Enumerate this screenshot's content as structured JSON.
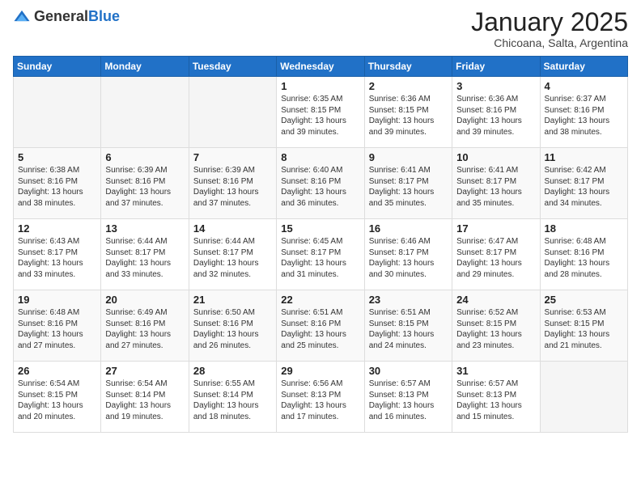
{
  "logo": {
    "general": "General",
    "blue": "Blue"
  },
  "header": {
    "month": "January 2025",
    "location": "Chicoana, Salta, Argentina"
  },
  "days_of_week": [
    "Sunday",
    "Monday",
    "Tuesday",
    "Wednesday",
    "Thursday",
    "Friday",
    "Saturday"
  ],
  "weeks": [
    [
      {
        "day": "",
        "info": ""
      },
      {
        "day": "",
        "info": ""
      },
      {
        "day": "",
        "info": ""
      },
      {
        "day": "1",
        "info": "Sunrise: 6:35 AM\nSunset: 8:15 PM\nDaylight: 13 hours and 39 minutes."
      },
      {
        "day": "2",
        "info": "Sunrise: 6:36 AM\nSunset: 8:15 PM\nDaylight: 13 hours and 39 minutes."
      },
      {
        "day": "3",
        "info": "Sunrise: 6:36 AM\nSunset: 8:16 PM\nDaylight: 13 hours and 39 minutes."
      },
      {
        "day": "4",
        "info": "Sunrise: 6:37 AM\nSunset: 8:16 PM\nDaylight: 13 hours and 38 minutes."
      }
    ],
    [
      {
        "day": "5",
        "info": "Sunrise: 6:38 AM\nSunset: 8:16 PM\nDaylight: 13 hours and 38 minutes."
      },
      {
        "day": "6",
        "info": "Sunrise: 6:39 AM\nSunset: 8:16 PM\nDaylight: 13 hours and 37 minutes."
      },
      {
        "day": "7",
        "info": "Sunrise: 6:39 AM\nSunset: 8:16 PM\nDaylight: 13 hours and 37 minutes."
      },
      {
        "day": "8",
        "info": "Sunrise: 6:40 AM\nSunset: 8:16 PM\nDaylight: 13 hours and 36 minutes."
      },
      {
        "day": "9",
        "info": "Sunrise: 6:41 AM\nSunset: 8:17 PM\nDaylight: 13 hours and 35 minutes."
      },
      {
        "day": "10",
        "info": "Sunrise: 6:41 AM\nSunset: 8:17 PM\nDaylight: 13 hours and 35 minutes."
      },
      {
        "day": "11",
        "info": "Sunrise: 6:42 AM\nSunset: 8:17 PM\nDaylight: 13 hours and 34 minutes."
      }
    ],
    [
      {
        "day": "12",
        "info": "Sunrise: 6:43 AM\nSunset: 8:17 PM\nDaylight: 13 hours and 33 minutes."
      },
      {
        "day": "13",
        "info": "Sunrise: 6:44 AM\nSunset: 8:17 PM\nDaylight: 13 hours and 33 minutes."
      },
      {
        "day": "14",
        "info": "Sunrise: 6:44 AM\nSunset: 8:17 PM\nDaylight: 13 hours and 32 minutes."
      },
      {
        "day": "15",
        "info": "Sunrise: 6:45 AM\nSunset: 8:17 PM\nDaylight: 13 hours and 31 minutes."
      },
      {
        "day": "16",
        "info": "Sunrise: 6:46 AM\nSunset: 8:17 PM\nDaylight: 13 hours and 30 minutes."
      },
      {
        "day": "17",
        "info": "Sunrise: 6:47 AM\nSunset: 8:17 PM\nDaylight: 13 hours and 29 minutes."
      },
      {
        "day": "18",
        "info": "Sunrise: 6:48 AM\nSunset: 8:16 PM\nDaylight: 13 hours and 28 minutes."
      }
    ],
    [
      {
        "day": "19",
        "info": "Sunrise: 6:48 AM\nSunset: 8:16 PM\nDaylight: 13 hours and 27 minutes."
      },
      {
        "day": "20",
        "info": "Sunrise: 6:49 AM\nSunset: 8:16 PM\nDaylight: 13 hours and 27 minutes."
      },
      {
        "day": "21",
        "info": "Sunrise: 6:50 AM\nSunset: 8:16 PM\nDaylight: 13 hours and 26 minutes."
      },
      {
        "day": "22",
        "info": "Sunrise: 6:51 AM\nSunset: 8:16 PM\nDaylight: 13 hours and 25 minutes."
      },
      {
        "day": "23",
        "info": "Sunrise: 6:51 AM\nSunset: 8:15 PM\nDaylight: 13 hours and 24 minutes."
      },
      {
        "day": "24",
        "info": "Sunrise: 6:52 AM\nSunset: 8:15 PM\nDaylight: 13 hours and 23 minutes."
      },
      {
        "day": "25",
        "info": "Sunrise: 6:53 AM\nSunset: 8:15 PM\nDaylight: 13 hours and 21 minutes."
      }
    ],
    [
      {
        "day": "26",
        "info": "Sunrise: 6:54 AM\nSunset: 8:15 PM\nDaylight: 13 hours and 20 minutes."
      },
      {
        "day": "27",
        "info": "Sunrise: 6:54 AM\nSunset: 8:14 PM\nDaylight: 13 hours and 19 minutes."
      },
      {
        "day": "28",
        "info": "Sunrise: 6:55 AM\nSunset: 8:14 PM\nDaylight: 13 hours and 18 minutes."
      },
      {
        "day": "29",
        "info": "Sunrise: 6:56 AM\nSunset: 8:13 PM\nDaylight: 13 hours and 17 minutes."
      },
      {
        "day": "30",
        "info": "Sunrise: 6:57 AM\nSunset: 8:13 PM\nDaylight: 13 hours and 16 minutes."
      },
      {
        "day": "31",
        "info": "Sunrise: 6:57 AM\nSunset: 8:13 PM\nDaylight: 13 hours and 15 minutes."
      },
      {
        "day": "",
        "info": ""
      }
    ]
  ]
}
